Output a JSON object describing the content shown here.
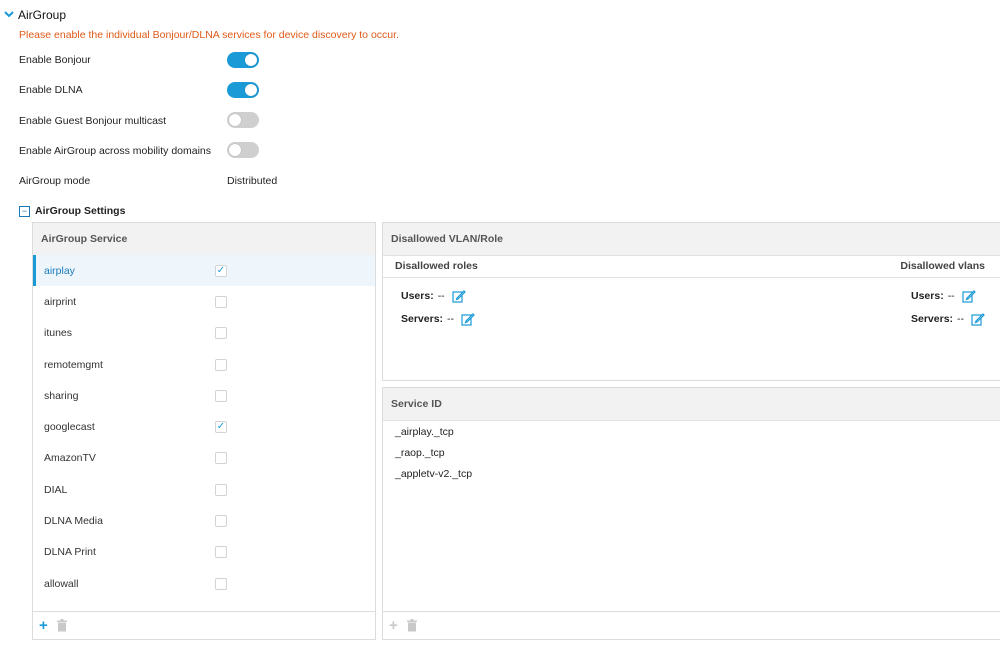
{
  "header": {
    "title": "AirGroup",
    "notice": "Please enable the individual Bonjour/DLNA services for device discovery to occur."
  },
  "settings_rows": [
    {
      "label": "Enable Bonjour",
      "enabled": true
    },
    {
      "label": "Enable DLNA",
      "enabled": true
    },
    {
      "label": "Enable Guest Bonjour multicast",
      "enabled": false
    },
    {
      "label": "Enable AirGroup across mobility domains",
      "enabled": false
    }
  ],
  "mode": {
    "label": "AirGroup mode",
    "value": "Distributed"
  },
  "airgroup_settings": {
    "title": "AirGroup Settings"
  },
  "service_panel": {
    "header": "AirGroup Service",
    "services": [
      {
        "name": "airplay",
        "checked": true,
        "selected": true
      },
      {
        "name": "airprint",
        "checked": false
      },
      {
        "name": "itunes",
        "checked": false
      },
      {
        "name": "remotemgmt",
        "checked": false
      },
      {
        "name": "sharing",
        "checked": false
      },
      {
        "name": "googlecast",
        "checked": true
      },
      {
        "name": "AmazonTV",
        "checked": false
      },
      {
        "name": "DIAL",
        "checked": false
      },
      {
        "name": "DLNA Media",
        "checked": false
      },
      {
        "name": "DLNA Print",
        "checked": false
      },
      {
        "name": "allowall",
        "checked": false
      }
    ]
  },
  "disallowed_panel": {
    "header": "Disallowed VLAN/Role",
    "roles_header": "Disallowed roles",
    "vlans_header": "Disallowed vlans",
    "users_label": "Users:",
    "users_roles_value": "--",
    "servers_label": "Servers:",
    "servers_roles_value": "--",
    "users_vlans_value": "--",
    "servers_vlans_value": "--"
  },
  "service_id_panel": {
    "header": "Service ID",
    "ids": [
      "_airplay._tcp",
      "_raop._tcp",
      "_appletv-v2._tcp"
    ]
  },
  "colors": {
    "accent": "#1a9ad6",
    "notice": "#e05a17",
    "toggle_off": "#cfcfcf"
  }
}
